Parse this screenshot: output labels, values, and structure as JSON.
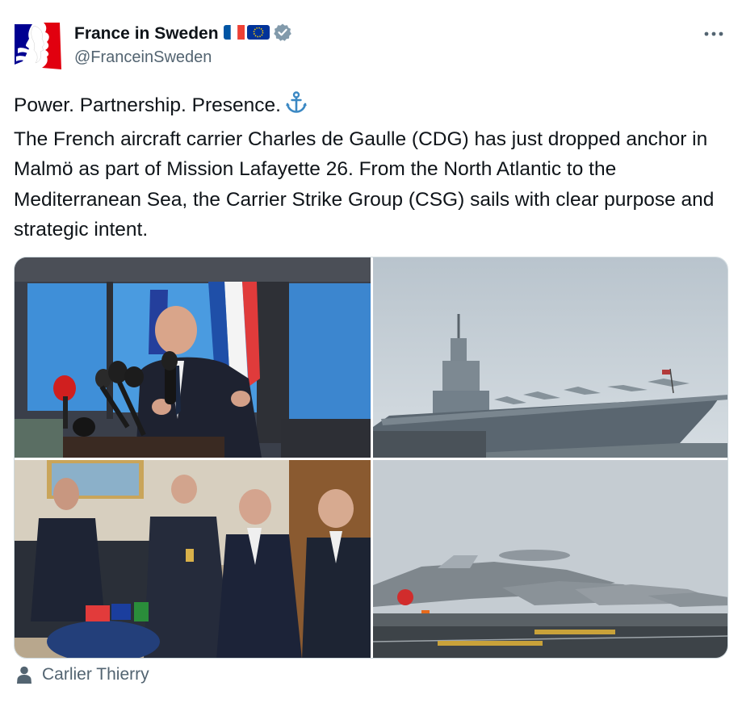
{
  "account": {
    "display_name": "France in Sweden",
    "handle": "@FranceinSweden",
    "verified": true,
    "flags": [
      "flag-france-icon",
      "flag-eu-icon"
    ]
  },
  "tweet": {
    "line1": "Power. Partnership. Presence.",
    "body": "The French aircraft carrier Charles de Gaulle (CDG) has just dropped anchor in Malmö as part of Mission Lafayette 26. From the North Atlantic to the Mediterranean Sea, the Carrier Strike Group (CSG) sails with clear purpose and strategic intent."
  },
  "media": {
    "photos": [
      {
        "icon": "press-conference-photo"
      },
      {
        "icon": "aircraft-carrier-photo"
      },
      {
        "icon": "meeting-photo"
      },
      {
        "icon": "fighter-jets-photo"
      }
    ],
    "photo_credit": "Carlier Thierry"
  },
  "colors": {
    "text": "#0f1419",
    "secondary": "#536471",
    "verified": "#829aab",
    "anchor": "#3b88c3",
    "france_blue": "#0055a4",
    "france_red": "#ef4135",
    "eu_blue": "#003399",
    "eu_gold": "#ffcc00"
  }
}
